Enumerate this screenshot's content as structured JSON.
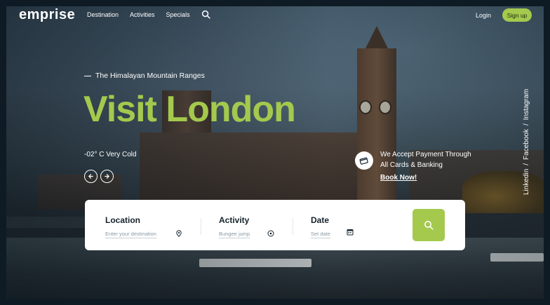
{
  "brand": {
    "logo": "emprise"
  },
  "nav": {
    "items": [
      "Destination",
      "Activities",
      "Specials"
    ],
    "login": "Login",
    "signup": "Sign up"
  },
  "hero": {
    "eyebrow": "The Himalayan Mountain Ranges",
    "title": "Visit London",
    "weather": "-02° C  Very Cold"
  },
  "payment": {
    "line1": "We Accept Payment Through",
    "line2": "All Cards & Banking",
    "cta": "Book Now!"
  },
  "socials": [
    "Linkedin",
    "/",
    "Facebook",
    "/",
    "Instagram"
  ],
  "search": {
    "location": {
      "label": "Location",
      "placeholder": "Enter your destination"
    },
    "activity": {
      "label": "Activity",
      "placeholder": "Bungee jump"
    },
    "date": {
      "label": "Date",
      "placeholder": "Set date"
    }
  },
  "colors": {
    "accent": "#a4c94d",
    "dark": "#15232c"
  }
}
